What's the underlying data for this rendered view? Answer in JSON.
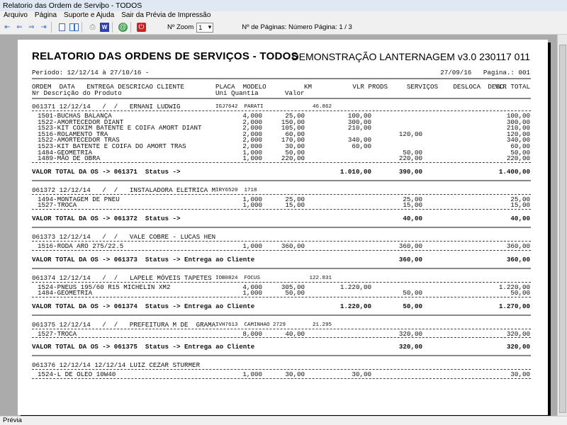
{
  "window": {
    "title": "Relatorio das Ordem de Serviþo  - TODOS"
  },
  "menu": [
    "Arquivo",
    "Página",
    "Suporte e Ajuda",
    "Sair da Prévia de Impressão"
  ],
  "toolbar": {
    "zoom_label": "Nº Zoom",
    "zoom_value": "1",
    "pages_label": "Nº de Páginas: Número Página: 1 / 3"
  },
  "status": "Prévia",
  "report": {
    "title": "RELATORIO DAS ORDENS DE SERVIÇOS  - TODOS",
    "company": "DEMONSTRAÇÃO LANTERNAGEM v3.0 230117 011",
    "period": "Período: 12/12/14 à 27/10/16 -",
    "date_page": "27/09/16   Pagina.: 001",
    "header1": {
      "ordem": "ORDEM  DATA   ENTREGA DESCRICAO CLIENTE",
      "placa": "PLACA  MODELO",
      "km": "KM",
      "vlr_prods": "VLR PRODS",
      "servicos": "SERVIÇOS",
      "desloca": "DESLOCA",
      "desc": "DESC.",
      "vlr_total": "VLR TOTAL"
    },
    "header2": {
      "nr": "Nr Descrição do Produto",
      "uni": "Uni Quantia",
      "valor": "Valor"
    },
    "orders": [
      {
        "head": "061371 12/12/14   /  /   ERNANI LUDWIG",
        "vehicle": "IGJ7642  PARATI",
        "km": "46.862",
        "items": [
          {
            "desc": "1501-BUCHAS BALANÇA",
            "qty": "4,000",
            "valor": "25,00",
            "prods": "100,00",
            "serv": "",
            "total": "100,00"
          },
          {
            "desc": "1522-AMORTECEDOR DIANT",
            "qty": "2,000",
            "valor": "150,00",
            "prods": "300,00",
            "serv": "",
            "total": "300,00"
          },
          {
            "desc": "1523-KIT COXIM BATENTE E COIFA AMORT DIANT",
            "qty": "2,000",
            "valor": "105,00",
            "prods": "210,00",
            "serv": "",
            "total": "210,00"
          },
          {
            "desc": "1516-ROLAMENTO TRA",
            "qty": "2,000",
            "valor": "60,00",
            "prods": "",
            "serv": "120,00",
            "total": "120,00"
          },
          {
            "desc": "1522-AMORTECEDOR TRAS",
            "qty": "2,000",
            "valor": "170,00",
            "prods": "340,00",
            "serv": "",
            "total": "340,00"
          },
          {
            "desc": "1523-KIT BATENTE E COIFA DO AMORT TRAS",
            "qty": "2,000",
            "valor": "30,00",
            "prods": "60,00",
            "serv": "",
            "total": "60,00"
          },
          {
            "desc": "1484-GEOMETRIA",
            "qty": "1,000",
            "valor": "50,00",
            "prods": "",
            "serv": "50,00",
            "total": "50,00"
          },
          {
            "desc": "1489-MÃO DE OBRA",
            "qty": "1,000",
            "valor": "220,00",
            "prods": "",
            "serv": "220,00",
            "total": "220,00"
          }
        ],
        "total": {
          "label": "VALOR TOTAL DA OS -> 061371  Status ->",
          "prods": "1.010,00",
          "serv": "390,00",
          "total": "1.400,00"
        }
      },
      {
        "head": "061372 12/12/14   /  /   INSTALADORA ELETRICA M",
        "vehicle": "IRY6520  1718",
        "km": "",
        "items": [
          {
            "desc": "1494-MONTAGEM DE PNEU",
            "qty": "1,000",
            "valor": "25,00",
            "prods": "",
            "serv": "25,00",
            "total": "25,00"
          },
          {
            "desc": "1527-TROCA",
            "qty": "1,000",
            "valor": "15,00",
            "prods": "",
            "serv": "15,00",
            "total": "15,00"
          }
        ],
        "total": {
          "label": "VALOR TOTAL DA OS -> 061372  Status ->",
          "prods": "",
          "serv": "40,00",
          "total": "40,00"
        }
      },
      {
        "head": "061373 12/12/14   /  /   VALE COBRE - LUCAS HEN",
        "vehicle": "",
        "km": "",
        "items": [
          {
            "desc": "1516-RODA ARO 275/22.5",
            "qty": "1,000",
            "valor": "360,00",
            "prods": "",
            "serv": "360,00",
            "total": "360,00"
          }
        ],
        "total": {
          "label": "VALOR TOTAL DA OS -> 061373  Status -> Entrega ao Cliente",
          "prods": "",
          "serv": "360,00",
          "total": "360,00"
        }
      },
      {
        "head": "061374 12/12/14   /  /   LAPELE MÓVEIS TAPETES",
        "vehicle": "IOB0824  FOCUS",
        "km": "122.831",
        "items": [
          {
            "desc": "1524-PNEUS 195/60 R15 MICHELIN XM2",
            "qty": "4,000",
            "valor": "305,00",
            "prods": "1.220,00",
            "serv": "",
            "total": "1.220,00"
          },
          {
            "desc": "1484-GEOMETRIA",
            "qty": "1,000",
            "valor": "50,00",
            "prods": "",
            "serv": "50,00",
            "total": "50,00"
          }
        ],
        "total": {
          "label": "VALOR TOTAL DA OS -> 061374  Status -> Entrega ao Cliente",
          "prods": "1.220,00",
          "serv": "50,00",
          "total": "1.270,00"
        }
      },
      {
        "head": "061375 12/12/14   /  /   PREFEITURA M DE  GRAMA",
        "vehicle": "IVH7613  CAMINHAO 2729",
        "km": "21.295",
        "items": [
          {
            "desc": "1527-TROCA",
            "qty": "8,000",
            "valor": "40,00",
            "prods": "",
            "serv": "320,00",
            "total": "320,00"
          }
        ],
        "total": {
          "label": "VALOR TOTAL DA OS -> 061375  Status -> Entrega ao Cliente",
          "prods": "",
          "serv": "320,00",
          "total": "320,00"
        }
      },
      {
        "head": "061376 12/12/14 12/12/14 LUIZ CEZAR STURMER",
        "vehicle": "",
        "km": "",
        "items": [
          {
            "desc": "1524-L DE OLEO 10W40",
            "qty": "1,000",
            "valor": "30,00",
            "prods": "30,00",
            "serv": "",
            "total": "30,00"
          }
        ]
      }
    ]
  }
}
